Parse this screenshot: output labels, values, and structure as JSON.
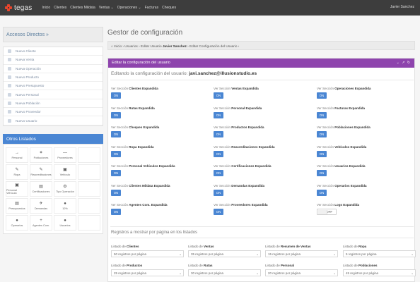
{
  "brand": {
    "name": "tegas"
  },
  "nav": [
    "Inicio",
    "Clientes",
    "Clientes Mildata",
    "Ventas ⌄",
    "Operaciones ⌄",
    "Facturas",
    "Cheques"
  ],
  "user": {
    "name": "Javier Sanchez"
  },
  "sidebar": {
    "accesos_title": "Accesos Directos »",
    "accesos": [
      "Nuevo Cliente",
      "Nueva Venta",
      "Nueva Operación",
      "Nuevo Producto",
      "Nuevo Presupuesto",
      "Nuevo Personal",
      "Nueva Población",
      "Nuevo Proveedor",
      "Nuevo Usuario"
    ],
    "otros_title": "Otros Listados",
    "otros": [
      {
        "label": "Personal",
        "icon": "→"
      },
      {
        "label": "Poblaciones",
        "icon": "✶"
      },
      {
        "label": "Proveedores",
        "icon": "—"
      },
      {
        "label": "",
        "icon": ""
      },
      {
        "label": "Ropa",
        "icon": "✎"
      },
      {
        "label": "Reacreditaciones",
        "icon": "✎"
      },
      {
        "label": "Vehículo",
        "icon": "▣"
      },
      {
        "label": "",
        "icon": ""
      },
      {
        "label": "Personal Vehículo",
        "icon": "▣"
      },
      {
        "label": "Certificaciones",
        "icon": "▤"
      },
      {
        "label": "Tipo Operación",
        "icon": "⚙"
      },
      {
        "label": "",
        "icon": ""
      },
      {
        "label": "Presupuestos",
        "icon": "▤"
      },
      {
        "label": "Demandas",
        "icon": "✈"
      },
      {
        "label": "10%",
        "icon": "●"
      },
      {
        "label": "",
        "icon": ""
      },
      {
        "label": "Operarios",
        "icon": "●"
      },
      {
        "label": "Agentes Com.",
        "icon": "+"
      },
      {
        "label": "Usuarios",
        "icon": "●"
      },
      {
        "label": "",
        "icon": ""
      }
    ]
  },
  "page": {
    "title": "Gestor de configuración",
    "breadcrumb_home": "Inicio",
    "breadcrumb_rest": " › Usuarios › Editar Usuario ",
    "breadcrumb_user": "Javier Sanchez",
    "breadcrumb_tail": " › Editar Configuración del Usuario ›"
  },
  "panel": {
    "title": "Editar la configuración del usuario",
    "tools": "⌄ ↗ ↻",
    "subtitle_prefix": "Editando la configuración del usuario: ",
    "subtitle_email": "javi.sanchez@illusionstudio.es",
    "label_prefix": "Ver Sección ",
    "settings": [
      {
        "name": "Clientes Expandida",
        "state": "ON"
      },
      {
        "name": "Ventas Expandida",
        "state": "ON"
      },
      {
        "name": "Operaciones Expandida",
        "state": "ON"
      },
      {
        "name": "Rutas Expandida",
        "state": "ON"
      },
      {
        "name": "Personal Expandida",
        "state": "ON"
      },
      {
        "name": "Facturas Expandida",
        "state": "ON"
      },
      {
        "name": "Cheques Expandida",
        "state": "ON"
      },
      {
        "name": "Productos Expandida",
        "state": "ON"
      },
      {
        "name": "Poblaciones Expandida",
        "state": "ON"
      },
      {
        "name": "Ropa Expandida",
        "state": "ON"
      },
      {
        "name": "Reacreditaciones Expandida",
        "state": "ON"
      },
      {
        "name": "Vehículos Expandida",
        "state": "ON"
      },
      {
        "name": "Personal Vehiculos Expandida",
        "state": "ON"
      },
      {
        "name": "Certificaciones Expandida",
        "state": "ON"
      },
      {
        "name": "Usuarios Expandida",
        "state": "ON"
      },
      {
        "name": "Clientes Mildata Expandida",
        "state": "ON"
      },
      {
        "name": "Demandas Expandida",
        "state": "ON"
      },
      {
        "name": "Operarios Expandida",
        "state": "ON"
      },
      {
        "name": "Agentes Com. Expandida",
        "state": "ON"
      },
      {
        "name": "Proveedores Expandida",
        "state": "ON"
      },
      {
        "name": "Logs Expandida",
        "state": "OFF"
      }
    ],
    "records_title": "Registros a mostrar por página en los listados",
    "records_prefix": "Listado de ",
    "records": [
      {
        "name": "Clientes",
        "value": "50 registros por página"
      },
      {
        "name": "Ventas",
        "value": "35 registros por página"
      },
      {
        "name": "Resumen de Ventas",
        "value": "15 registros por página"
      },
      {
        "name": "Ropa",
        "value": "5 registros por página"
      },
      {
        "name": "Productos",
        "value": "25 registros por página"
      },
      {
        "name": "Rutas",
        "value": "30 registros por página"
      },
      {
        "name": "Personal",
        "value": "20 registros por página"
      },
      {
        "name": "Poblaciones",
        "value": "45 registros por página"
      }
    ]
  }
}
